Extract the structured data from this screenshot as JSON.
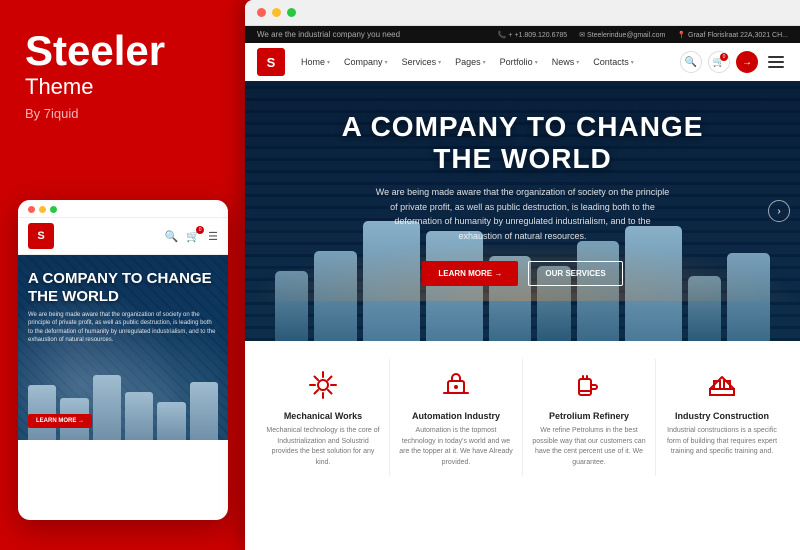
{
  "brand": {
    "title": "Steeler",
    "subtitle": "Theme",
    "by": "By 7iquid"
  },
  "browser": {
    "dots": [
      "#ff5f57",
      "#ffbd2e",
      "#28c840"
    ]
  },
  "mobile": {
    "dots": [
      "#ff5f57",
      "#ffbd2e",
      "#28c840"
    ],
    "logo": "S",
    "hero_title": "A COMPANY TO CHANGE THE WORLD",
    "hero_desc": "We are being made aware that the organization of society on the principle of private profit, as well as public destruction, is leading both to the deformation of humanity by unregulated industrialism, and to the exhaustion of natural resources.",
    "learn_btn": "LEARN MORE →"
  },
  "topbar": {
    "tagline": "We are the industrial company you need",
    "phone": "+ +1.809.120.6785",
    "email": "Steelerindue@gmail.com",
    "address": "Graaf Florislraat 22A,3021 CH..."
  },
  "nav": {
    "logo": "S",
    "items": [
      {
        "label": "Home",
        "has_dropdown": true
      },
      {
        "label": "Company",
        "has_dropdown": true
      },
      {
        "label": "Services",
        "has_dropdown": true
      },
      {
        "label": "Pages",
        "has_dropdown": true
      },
      {
        "label": "Portfolio",
        "has_dropdown": true
      },
      {
        "label": "News",
        "has_dropdown": true
      },
      {
        "label": "Contacts",
        "has_dropdown": true
      }
    ]
  },
  "hero": {
    "title_line1": "A COMPANY TO CHANGE",
    "title_line2": "THE WORLD",
    "subtitle": "We are being made aware that the organization of society on the principle of private profit, as well as public destruction, is leading both to the deformation of humanity by unregulated industrialism, and to the exhaustion of natural resources.",
    "btn_primary": "LEARN MORE →",
    "btn_secondary": "OUR SERVICES"
  },
  "services": [
    {
      "title": "Mechanical Works",
      "desc": "Mechanical technology is the core of Industrialization and Solustrid provides the best solution for any kind.",
      "icon": "gear"
    },
    {
      "title": "Automation Industry",
      "desc": "Automation is the topmost technology in today's world and we are the topper at it. We have Already provided.",
      "icon": "robot"
    },
    {
      "title": "Petrolium Refinery",
      "desc": "We refine Petrolums in the best possible way that our customers can have the cent percent use of it. We guarantee.",
      "icon": "oil"
    },
    {
      "title": "Industry Construction",
      "desc": "Industrial constructions is a specific form of building that requires expert training and specific training and.",
      "icon": "building"
    }
  ],
  "colors": {
    "red": "#cc0000",
    "dark": "#1a1a1a",
    "light_bg": "#f0f0f0"
  }
}
